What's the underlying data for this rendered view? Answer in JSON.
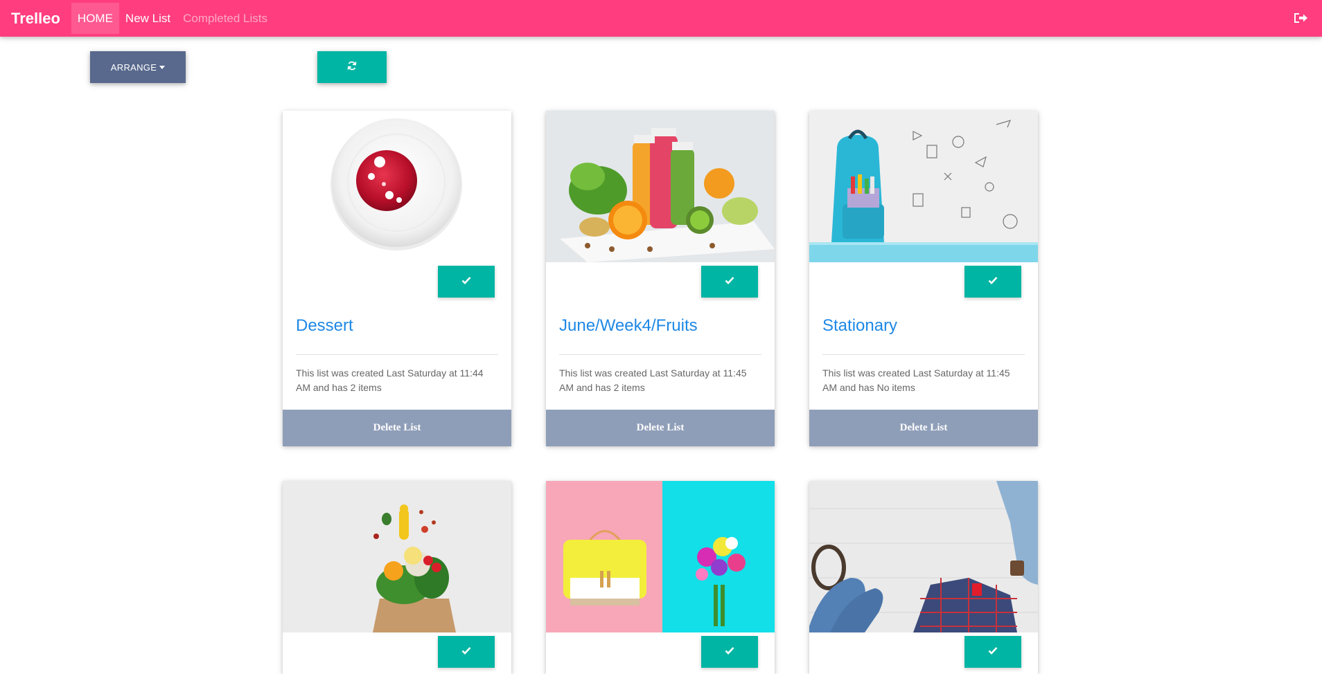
{
  "nav": {
    "brand": "Trelleo",
    "links": [
      {
        "label": "HOME"
      },
      {
        "label": "New List"
      },
      {
        "label": "Completed Lists"
      }
    ],
    "logout_icon": "sign-out-icon"
  },
  "toolbar": {
    "arrange_label": "ARRANGE",
    "refresh_icon": "refresh-icon"
  },
  "cards": [
    {
      "title": "Dessert",
      "text": "This list was created Last Saturday at 11:44 AM and has 2 items",
      "delete_label": "Delete List",
      "image": "dessert-image"
    },
    {
      "title": "June/Week4/Fruits",
      "text": "This list was created Last Saturday at 11:45 AM and has 2 items",
      "delete_label": "Delete List",
      "image": "fruits-image"
    },
    {
      "title": "Stationary",
      "text": "This list was created Last Saturday at 11:45 AM and has No items",
      "delete_label": "Delete List",
      "image": "stationary-image"
    },
    {
      "title": "",
      "text": "",
      "delete_label": "",
      "image": "groceries-image"
    },
    {
      "title": "",
      "text": "",
      "delete_label": "",
      "image": "bag-flowers-image"
    },
    {
      "title": "",
      "text": "",
      "delete_label": "",
      "image": "clothes-image"
    }
  ],
  "colors": {
    "navbar": "#ff3d7f",
    "accent": "#00b5a3",
    "arrange": "#59698d",
    "delete": "#8f9eb8",
    "title": "#1e88e5"
  }
}
